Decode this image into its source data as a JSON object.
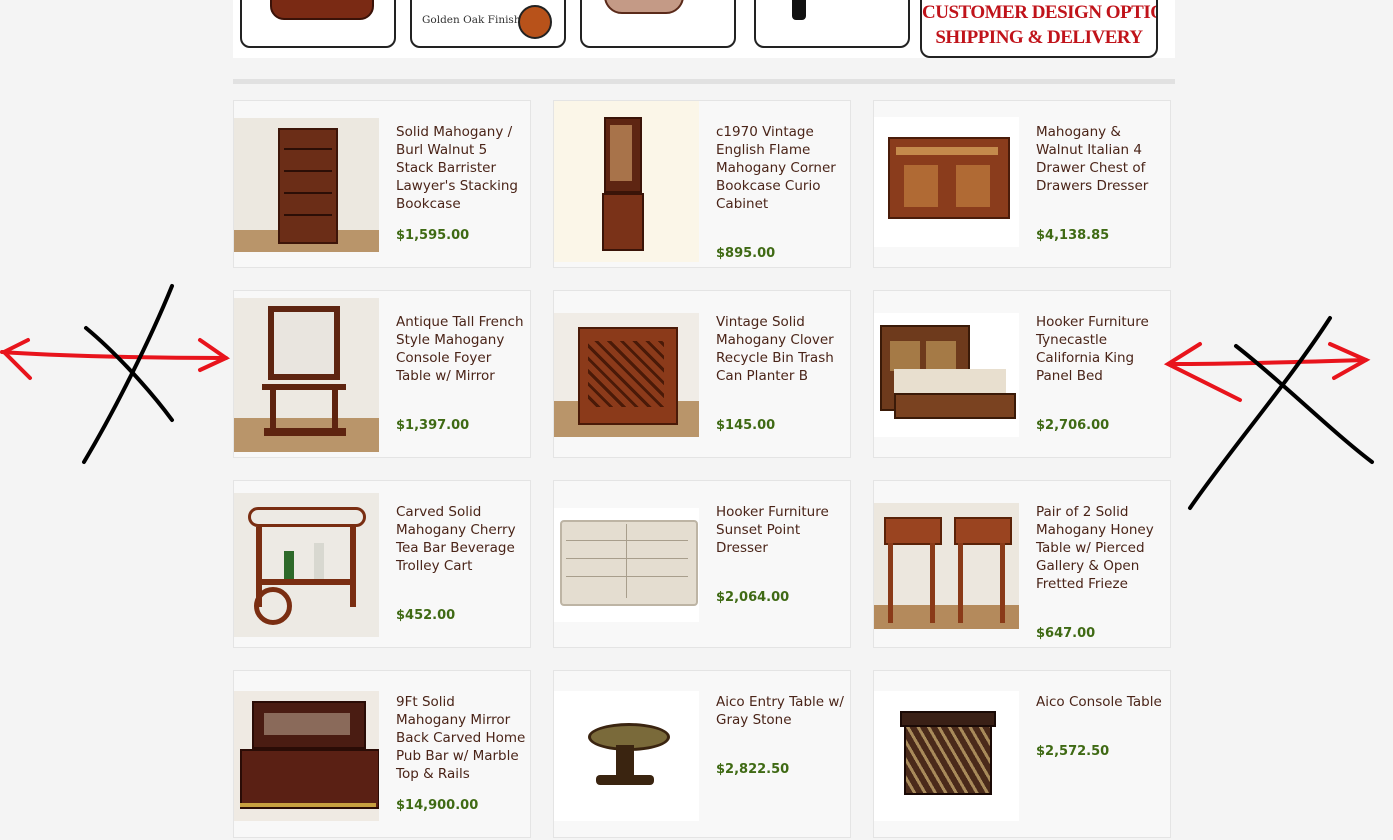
{
  "banner": {
    "golden_label": "Golden Oak Finish",
    "custom_line1": "CUSTOMER DESIGN OPTIONS",
    "custom_line2": "SHIPPING & DELIVERY"
  },
  "products": [
    {
      "title": "Solid Mahogany / Burl Walnut 5 Stack Barrister Lawyer's Stacking Bookcase",
      "price": "$1,595.00"
    },
    {
      "title": "c1970 Vintage English Flame Mahogany Corner Bookcase Curio Cabinet",
      "price": "$895.00"
    },
    {
      "title": "Mahogany & Walnut Italian 4 Drawer Chest of Drawers Dresser",
      "price": "$4,138.85"
    },
    {
      "title": "Antique Tall French Style Mahogany Console Foyer Table w/ Mirror",
      "price": "$1,397.00"
    },
    {
      "title": "Vintage Solid Mahogany Clover Recycle Bin Trash Can Planter B",
      "price": "$145.00"
    },
    {
      "title": "Hooker Furniture Tynecastle California King Panel Bed",
      "price": "$2,706.00"
    },
    {
      "title": "Carved Solid Mahogany Cherry Tea Bar Beverage Trolley Cart",
      "price": "$452.00"
    },
    {
      "title": "Hooker Furniture Sunset Point Dresser",
      "price": "$2,064.00"
    },
    {
      "title": "Pair of 2 Solid Mahogany Honey Table w/ Pierced Gallery & Open Fretted Frieze",
      "price": "$647.00"
    },
    {
      "title": "9Ft Solid Mahogany Mirror Back Carved Home Pub Bar w/ Marble Top & Rails",
      "price": "$14,900.00"
    },
    {
      "title": "Aico Entry Table w/ Gray Stone",
      "price": "$2,822.50"
    },
    {
      "title": "Aico Console Table",
      "price": "$2,572.50"
    }
  ],
  "colors": {
    "price": "#3f6a14",
    "title": "#4a2418",
    "annotation_arrow": "#e8141c",
    "annotation_cross": "#000000"
  }
}
